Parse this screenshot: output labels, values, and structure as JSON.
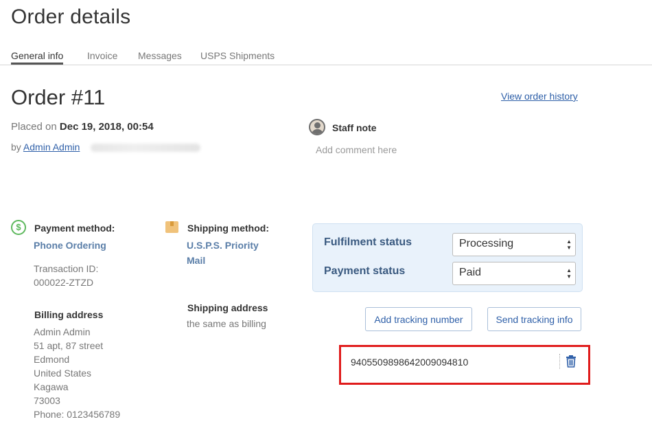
{
  "page": {
    "title": "Order details"
  },
  "tabs": [
    {
      "label": "General info",
      "active": true
    },
    {
      "label": "Invoice",
      "active": false
    },
    {
      "label": "Messages",
      "active": false
    },
    {
      "label": "USPS Shipments",
      "active": false
    }
  ],
  "order": {
    "number": "Order #11",
    "history_link": "View order history",
    "placed_prefix": "Placed on",
    "placed_date": "Dec 19, 2018, 00:54",
    "by_prefix": "by",
    "by_user": "Admin Admin"
  },
  "staff_note": {
    "title": "Staff note",
    "placeholder": "Add comment here",
    "icon": "user-avatar-icon"
  },
  "payment": {
    "icon": "dollar-icon",
    "label": "Payment method:",
    "method": "Phone Ordering",
    "transaction_label": "Transaction ID:",
    "transaction_id": "000022-ZTZD"
  },
  "shipping": {
    "icon": "package-icon",
    "label": "Shipping method:",
    "method_line1": "U.S.P.S. Priority",
    "method_line2": "Mail",
    "address_label": "Shipping address",
    "address_value": "the same as billing"
  },
  "billing": {
    "label": "Billing address",
    "lines": [
      "Admin Admin",
      "51 apt, 87 street",
      "Edmond",
      "United States",
      "Kagawa",
      "73003",
      "Phone: 0123456789"
    ]
  },
  "status": {
    "fulfilment_label": "Fulfilment status",
    "fulfilment_value": "Processing",
    "payment_label": "Payment status",
    "payment_value": "Paid"
  },
  "actions": {
    "add_tracking": "Add tracking number",
    "send_tracking": "Send tracking info"
  },
  "tracking": {
    "number": "9405509898642009094810",
    "highlight_color": "#e01b1b"
  },
  "colors": {
    "link": "#2e5fa8",
    "accent_green": "#5cb85c",
    "panel_bg": "#e9f2fb"
  }
}
